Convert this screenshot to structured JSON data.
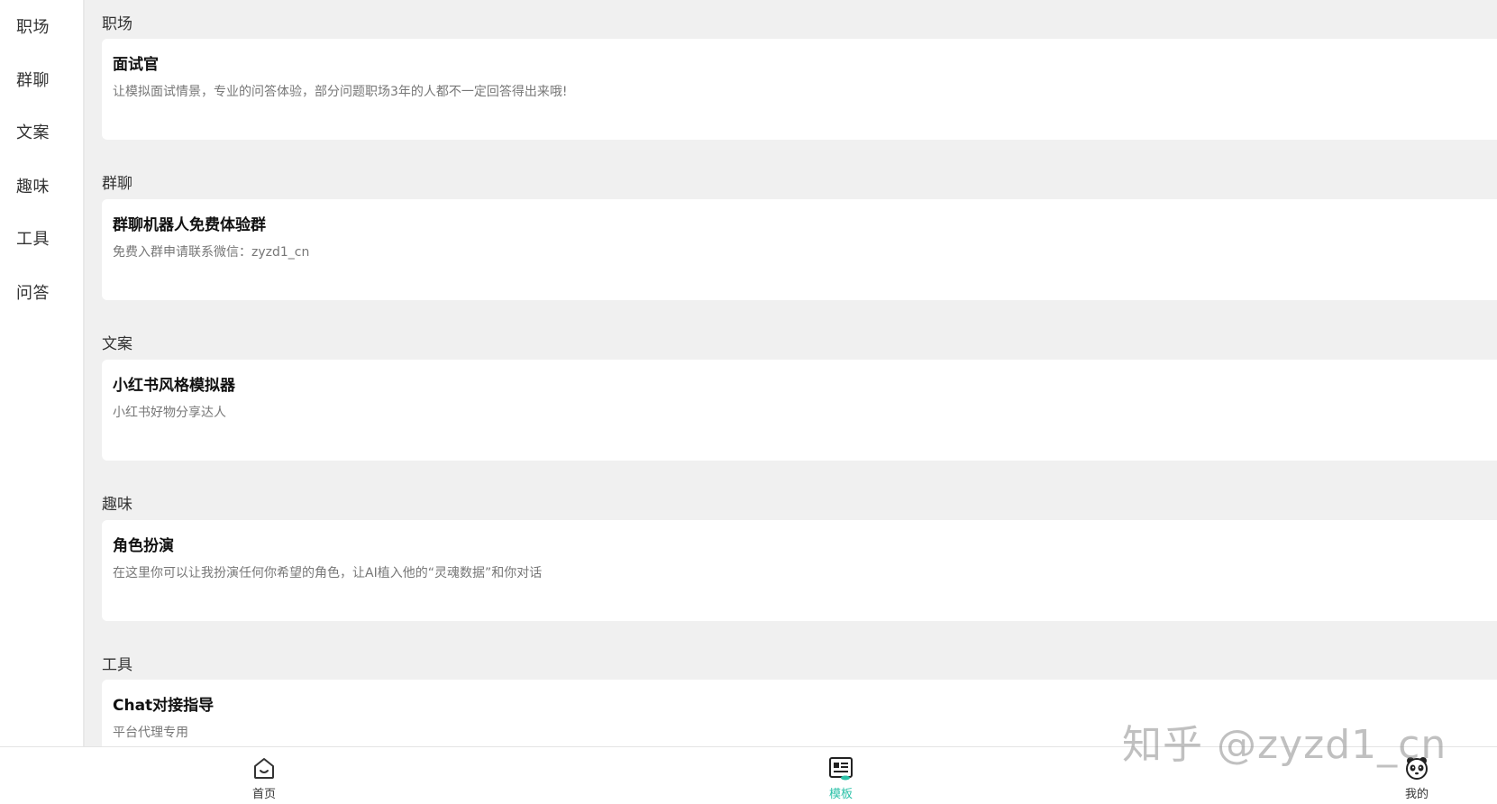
{
  "sidebar": {
    "items": [
      {
        "label": "职场"
      },
      {
        "label": "群聊"
      },
      {
        "label": "文案"
      },
      {
        "label": "趣味"
      },
      {
        "label": "工具"
      },
      {
        "label": "问答"
      }
    ]
  },
  "sections": [
    {
      "title": "职场",
      "card": {
        "title": "面试官",
        "desc": "让模拟面试情景，专业的问答体验，部分问题职场3年的人都不一定回答得出来哦!"
      }
    },
    {
      "title": "群聊",
      "card": {
        "title": "群聊机器人免费体验群",
        "desc": "免费入群申请联系微信：zyzd1_cn"
      }
    },
    {
      "title": "文案",
      "card": {
        "title": "小红书风格模拟器",
        "desc": "小红书好物分享达人"
      }
    },
    {
      "title": "趣味",
      "card": {
        "title": "角色扮演",
        "desc": "在这里你可以让我扮演任何你希望的角色，让AI植入他的“灵魂数据”和你对话"
      }
    },
    {
      "title": "工具",
      "card": {
        "title": "Chat对接指导",
        "desc": "平台代理专用"
      }
    }
  ],
  "bottom_nav": {
    "items": [
      {
        "label": "首页",
        "icon": "home-icon",
        "active": false
      },
      {
        "label": "模板",
        "icon": "template-icon",
        "active": true
      },
      {
        "label": "我的",
        "icon": "panda-avatar-icon",
        "active": false
      }
    ]
  },
  "watermark": "知乎 @zyzd1_cn",
  "colors": {
    "accent": "#2bc1a8",
    "background": "#f0f0f0",
    "card": "#ffffff"
  }
}
